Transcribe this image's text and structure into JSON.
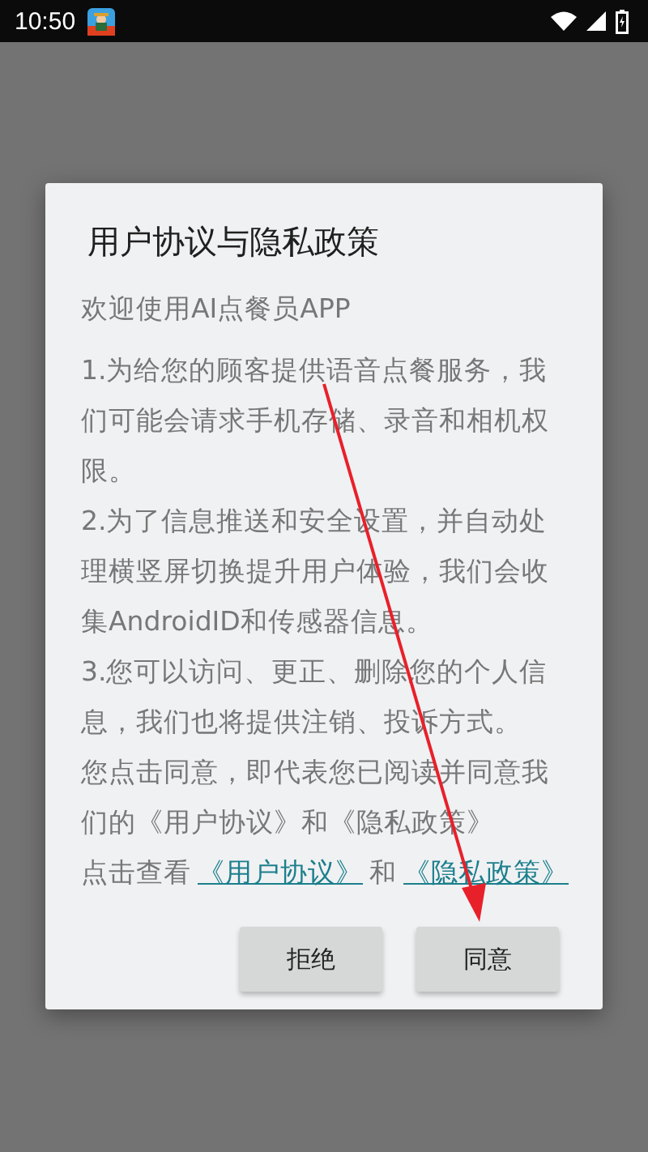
{
  "status_bar": {
    "time": "10:50"
  },
  "dialog": {
    "title": "用户协议与隐私政策",
    "intro": "欢迎使用AI点餐员APP",
    "paragraphs": [
      "1.为给您的顾客提供语音点餐服务，我们可能会请求手机存储、录音和相机权限。",
      "2.为了信息推送和安全设置，并自动处理横竖屏切换提升用户体验，我们会收集AndroidID和传感器信息。",
      "3.您可以访问、更正、删除您的个人信息，我们也将提供注销、投诉方式。",
      "您点击同意，即代表您已阅读并同意我们的《用户协议》和《隐私政策》"
    ],
    "link_line": [
      {
        "kind": "text",
        "text": "点击查看"
      },
      {
        "kind": "link",
        "text": "《用户协议》"
      },
      {
        "kind": "text",
        "text": "和"
      },
      {
        "kind": "link",
        "text": "《隐私政策》"
      }
    ],
    "buttons": [
      {
        "label": "拒绝"
      },
      {
        "label": "同意"
      }
    ]
  }
}
